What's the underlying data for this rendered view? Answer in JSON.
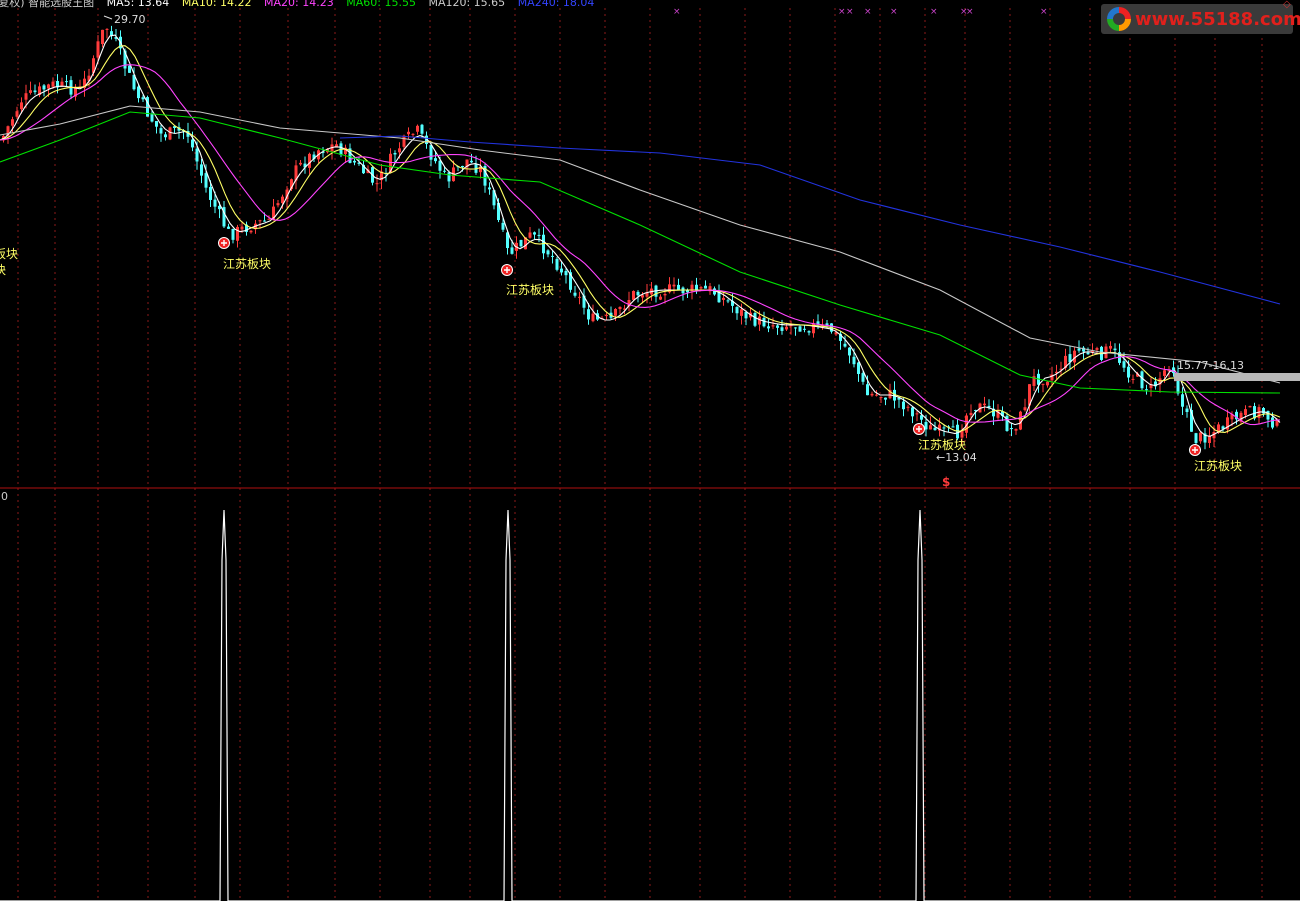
{
  "header": {
    "indicator_name": "(复权) 智能选股王图",
    "ma_items": [
      {
        "label": "MA5: 13.64",
        "color": "#ffffff"
      },
      {
        "label": "MA10: 14.22",
        "color": "#ffff66"
      },
      {
        "label": "MA20: 14.23",
        "color": "#ff44ff"
      },
      {
        "label": "MA60: 15.55",
        "color": "#00e000"
      },
      {
        "label": "MA120: 15.65",
        "color": "#cccccc"
      },
      {
        "label": "MA240: 18.04",
        "color": "#3344ff"
      }
    ]
  },
  "watermark": {
    "text": "www.55188.com"
  },
  "annotations": {
    "high_price": "29.70",
    "low_price": "←13.04",
    "range_label": "15.77-16.13",
    "signal_label": "江苏板块",
    "left_edge_labels": [
      "板块",
      "块"
    ],
    "signal_marker": "$",
    "lower_axis_value": "0"
  },
  "colors": {
    "background": "#000000",
    "up_candle": "#ff3b3b",
    "down_candle": "#54ffff",
    "grid": "#8b1a1a",
    "signal_text": "#ffff66",
    "lower_line": "#ffffff"
  },
  "chart_data": {
    "type": "line",
    "title": "",
    "series": [
      {
        "name": "MA5",
        "values": []
      },
      {
        "name": "MA240",
        "values": []
      }
    ],
    "marked_prices": [
      29.7,
      13.04
    ],
    "price_band": [
      15.77,
      16.13
    ],
    "signals": [
      "江苏板块",
      "江苏板块",
      "江苏板块",
      "江苏板块"
    ],
    "lower_panel": {
      "type": "line",
      "spike_count": 3,
      "baseline": 0
    }
  }
}
